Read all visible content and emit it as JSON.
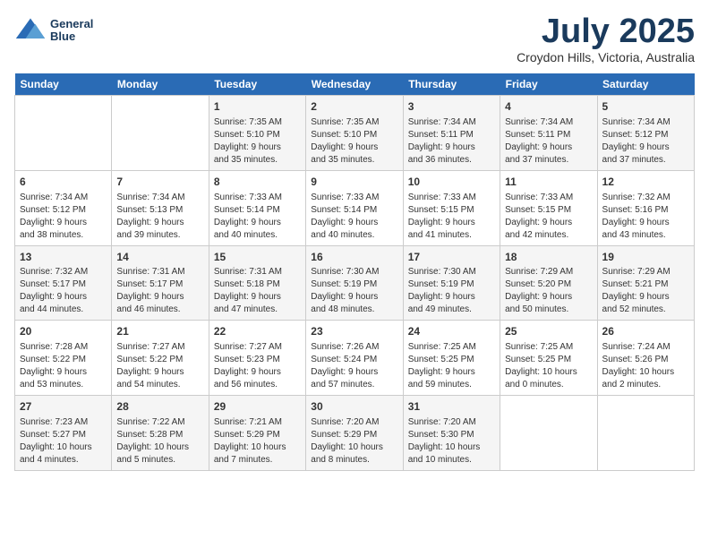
{
  "header": {
    "logo_line1": "General",
    "logo_line2": "Blue",
    "month": "July 2025",
    "location": "Croydon Hills, Victoria, Australia"
  },
  "days_of_week": [
    "Sunday",
    "Monday",
    "Tuesday",
    "Wednesday",
    "Thursday",
    "Friday",
    "Saturday"
  ],
  "weeks": [
    [
      {
        "day": "",
        "info": ""
      },
      {
        "day": "",
        "info": ""
      },
      {
        "day": "1",
        "info": "Sunrise: 7:35 AM\nSunset: 5:10 PM\nDaylight: 9 hours\nand 35 minutes."
      },
      {
        "day": "2",
        "info": "Sunrise: 7:35 AM\nSunset: 5:10 PM\nDaylight: 9 hours\nand 35 minutes."
      },
      {
        "day": "3",
        "info": "Sunrise: 7:34 AM\nSunset: 5:11 PM\nDaylight: 9 hours\nand 36 minutes."
      },
      {
        "day": "4",
        "info": "Sunrise: 7:34 AM\nSunset: 5:11 PM\nDaylight: 9 hours\nand 37 minutes."
      },
      {
        "day": "5",
        "info": "Sunrise: 7:34 AM\nSunset: 5:12 PM\nDaylight: 9 hours\nand 37 minutes."
      }
    ],
    [
      {
        "day": "6",
        "info": "Sunrise: 7:34 AM\nSunset: 5:12 PM\nDaylight: 9 hours\nand 38 minutes."
      },
      {
        "day": "7",
        "info": "Sunrise: 7:34 AM\nSunset: 5:13 PM\nDaylight: 9 hours\nand 39 minutes."
      },
      {
        "day": "8",
        "info": "Sunrise: 7:33 AM\nSunset: 5:14 PM\nDaylight: 9 hours\nand 40 minutes."
      },
      {
        "day": "9",
        "info": "Sunrise: 7:33 AM\nSunset: 5:14 PM\nDaylight: 9 hours\nand 40 minutes."
      },
      {
        "day": "10",
        "info": "Sunrise: 7:33 AM\nSunset: 5:15 PM\nDaylight: 9 hours\nand 41 minutes."
      },
      {
        "day": "11",
        "info": "Sunrise: 7:33 AM\nSunset: 5:15 PM\nDaylight: 9 hours\nand 42 minutes."
      },
      {
        "day": "12",
        "info": "Sunrise: 7:32 AM\nSunset: 5:16 PM\nDaylight: 9 hours\nand 43 minutes."
      }
    ],
    [
      {
        "day": "13",
        "info": "Sunrise: 7:32 AM\nSunset: 5:17 PM\nDaylight: 9 hours\nand 44 minutes."
      },
      {
        "day": "14",
        "info": "Sunrise: 7:31 AM\nSunset: 5:17 PM\nDaylight: 9 hours\nand 46 minutes."
      },
      {
        "day": "15",
        "info": "Sunrise: 7:31 AM\nSunset: 5:18 PM\nDaylight: 9 hours\nand 47 minutes."
      },
      {
        "day": "16",
        "info": "Sunrise: 7:30 AM\nSunset: 5:19 PM\nDaylight: 9 hours\nand 48 minutes."
      },
      {
        "day": "17",
        "info": "Sunrise: 7:30 AM\nSunset: 5:19 PM\nDaylight: 9 hours\nand 49 minutes."
      },
      {
        "day": "18",
        "info": "Sunrise: 7:29 AM\nSunset: 5:20 PM\nDaylight: 9 hours\nand 50 minutes."
      },
      {
        "day": "19",
        "info": "Sunrise: 7:29 AM\nSunset: 5:21 PM\nDaylight: 9 hours\nand 52 minutes."
      }
    ],
    [
      {
        "day": "20",
        "info": "Sunrise: 7:28 AM\nSunset: 5:22 PM\nDaylight: 9 hours\nand 53 minutes."
      },
      {
        "day": "21",
        "info": "Sunrise: 7:27 AM\nSunset: 5:22 PM\nDaylight: 9 hours\nand 54 minutes."
      },
      {
        "day": "22",
        "info": "Sunrise: 7:27 AM\nSunset: 5:23 PM\nDaylight: 9 hours\nand 56 minutes."
      },
      {
        "day": "23",
        "info": "Sunrise: 7:26 AM\nSunset: 5:24 PM\nDaylight: 9 hours\nand 57 minutes."
      },
      {
        "day": "24",
        "info": "Sunrise: 7:25 AM\nSunset: 5:25 PM\nDaylight: 9 hours\nand 59 minutes."
      },
      {
        "day": "25",
        "info": "Sunrise: 7:25 AM\nSunset: 5:25 PM\nDaylight: 10 hours\nand 0 minutes."
      },
      {
        "day": "26",
        "info": "Sunrise: 7:24 AM\nSunset: 5:26 PM\nDaylight: 10 hours\nand 2 minutes."
      }
    ],
    [
      {
        "day": "27",
        "info": "Sunrise: 7:23 AM\nSunset: 5:27 PM\nDaylight: 10 hours\nand 4 minutes."
      },
      {
        "day": "28",
        "info": "Sunrise: 7:22 AM\nSunset: 5:28 PM\nDaylight: 10 hours\nand 5 minutes."
      },
      {
        "day": "29",
        "info": "Sunrise: 7:21 AM\nSunset: 5:29 PM\nDaylight: 10 hours\nand 7 minutes."
      },
      {
        "day": "30",
        "info": "Sunrise: 7:20 AM\nSunset: 5:29 PM\nDaylight: 10 hours\nand 8 minutes."
      },
      {
        "day": "31",
        "info": "Sunrise: 7:20 AM\nSunset: 5:30 PM\nDaylight: 10 hours\nand 10 minutes."
      },
      {
        "day": "",
        "info": ""
      },
      {
        "day": "",
        "info": ""
      }
    ]
  ]
}
